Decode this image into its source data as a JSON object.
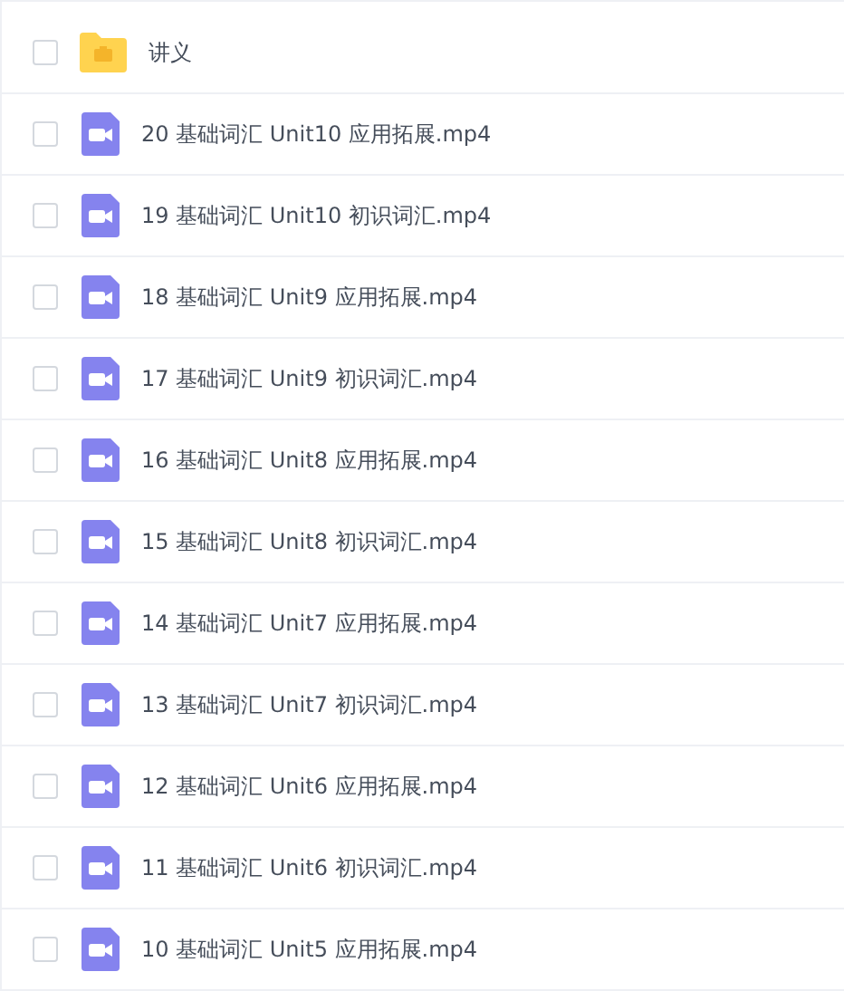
{
  "files": [
    {
      "kind": "folder",
      "name": "讲义",
      "checked": false
    },
    {
      "kind": "video",
      "name": "20 基础词汇 Unit10 应用拓展.mp4",
      "checked": false
    },
    {
      "kind": "video",
      "name": "19 基础词汇 Unit10 初识词汇.mp4",
      "checked": false
    },
    {
      "kind": "video",
      "name": "18 基础词汇 Unit9 应用拓展.mp4",
      "checked": false
    },
    {
      "kind": "video",
      "name": "17 基础词汇 Unit9 初识词汇.mp4",
      "checked": false
    },
    {
      "kind": "video",
      "name": "16 基础词汇 Unit8 应用拓展.mp4",
      "checked": false
    },
    {
      "kind": "video",
      "name": "15 基础词汇 Unit8 初识词汇.mp4",
      "checked": false
    },
    {
      "kind": "video",
      "name": "14 基础词汇 Unit7 应用拓展.mp4",
      "checked": false
    },
    {
      "kind": "video",
      "name": "13 基础词汇 Unit7 初识词汇.mp4",
      "checked": false
    },
    {
      "kind": "video",
      "name": "12 基础词汇 Unit6 应用拓展.mp4",
      "checked": false
    },
    {
      "kind": "video",
      "name": "11 基础词汇 Unit6 初识词汇.mp4",
      "checked": false
    },
    {
      "kind": "video",
      "name": "10 基础词汇 Unit5 应用拓展.mp4",
      "checked": false
    }
  ]
}
